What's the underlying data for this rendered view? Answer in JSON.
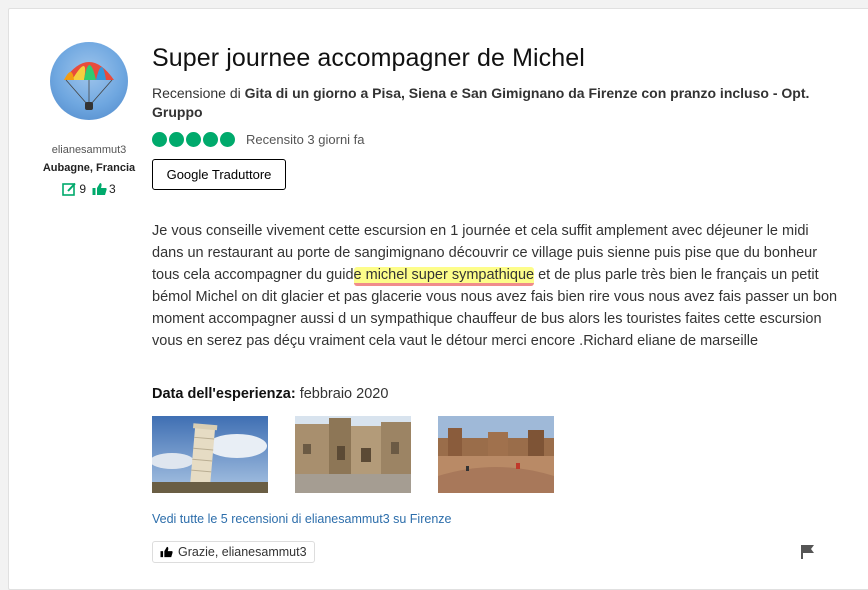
{
  "review": {
    "user": {
      "username": "elianesammut3",
      "location": "Aubagne, Francia",
      "contributions": "9",
      "helpful_votes": "3",
      "avatar_icon": "parasailing-avatar"
    },
    "title": "Super journee accompagner de Michel",
    "subtitle_prefix": "Recensione di ",
    "tour_name": "Gita di un giorno a Pisa, Siena e San Gimignano da Firenze con pranzo incluso - Opt. Gruppo",
    "rating": 5,
    "rating_color": "#00aa6c",
    "reviewed_date": "Recensito 3 giorni fa",
    "translate_button": "Google Traduttore",
    "body_before": "Je vous conseille vivement cette escursion en 1 journée et cela suffit amplement avec déjeuner le midi dans un restaurant au porte de sangimignano découvrir ce village puis sienne puis pise que du bonheur tous cela accompagner du guid",
    "body_highlight": "e michel super sympathique",
    "body_after": " et de plus parle très bien le français un petit bémol Michel on dit glacier et pas glacerie vous nous avez fais bien rire vous nous avez fais passer un bon moment accompagner aussi d un sympathique chauffeur de bus alors les touristes faites cette escursion vous en serez pas déçu vraiment cela vaut le détour merci encore .Richard eliane de marseille",
    "experience_label": "Data dell'esperienza:",
    "experience_date": " febbraio 2020",
    "photos": [
      "leaning-tower-of-pisa-photo",
      "san-gimignano-piazza-photo",
      "siena-piazza-del-campo-photo"
    ],
    "see_all_link": "Vedi tutte le 5 recensioni di elianesammut3 su Firenze",
    "thanks_button": "Grazie, elianesammut3",
    "link_color": "#2d6eab"
  }
}
